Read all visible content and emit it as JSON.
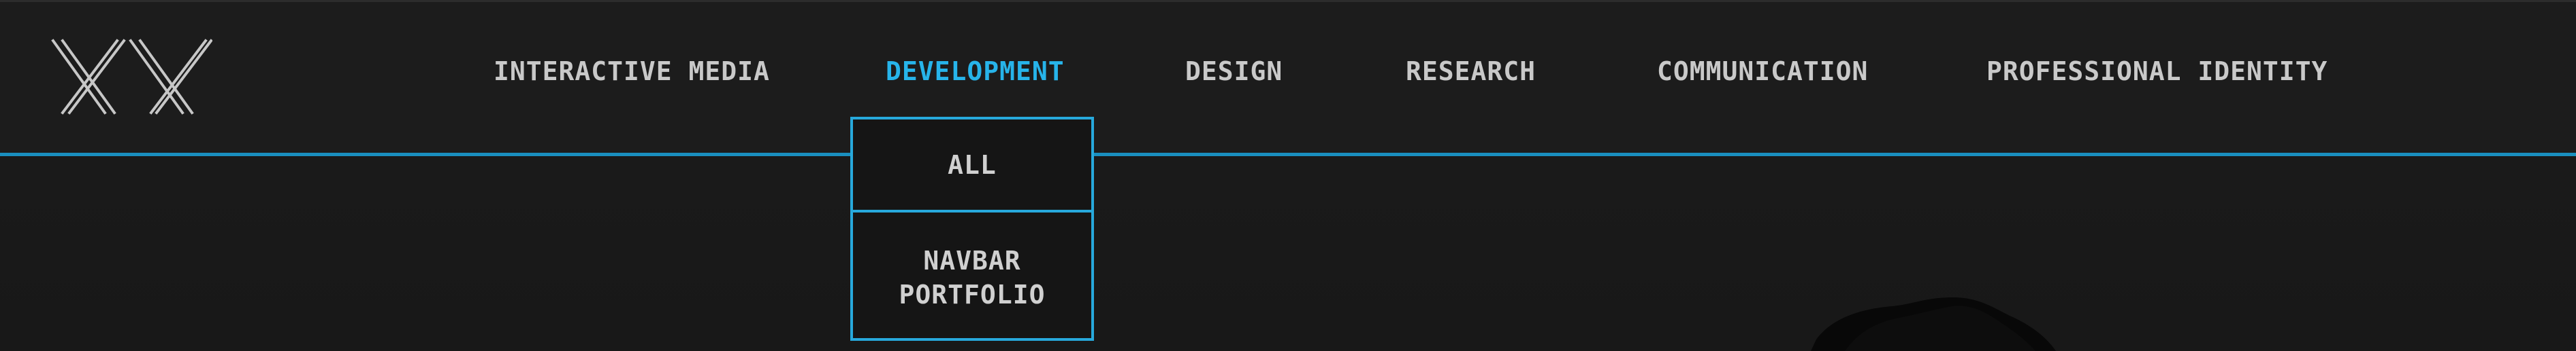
{
  "logo": {
    "text": "XX"
  },
  "nav": {
    "items": [
      {
        "label": "INTERACTIVE MEDIA"
      },
      {
        "label": "DEVELOPMENT",
        "active": true
      },
      {
        "label": "DESIGN"
      },
      {
        "label": "RESEARCH"
      },
      {
        "label": "COMMUNICATION"
      },
      {
        "label": "PROFESSIONAL IDENTITY"
      }
    ]
  },
  "dropdown": {
    "items": [
      {
        "label": "ALL"
      },
      {
        "label_line1": "NAVBAR",
        "label_line2": "PORTFOLIO"
      }
    ]
  },
  "colors": {
    "accent": "#27b4ea",
    "background": "#1b1b1b",
    "nav_text": "#c9c9c9"
  },
  "icons": [
    "logo-xx-icon",
    "hero-silhouette"
  ]
}
